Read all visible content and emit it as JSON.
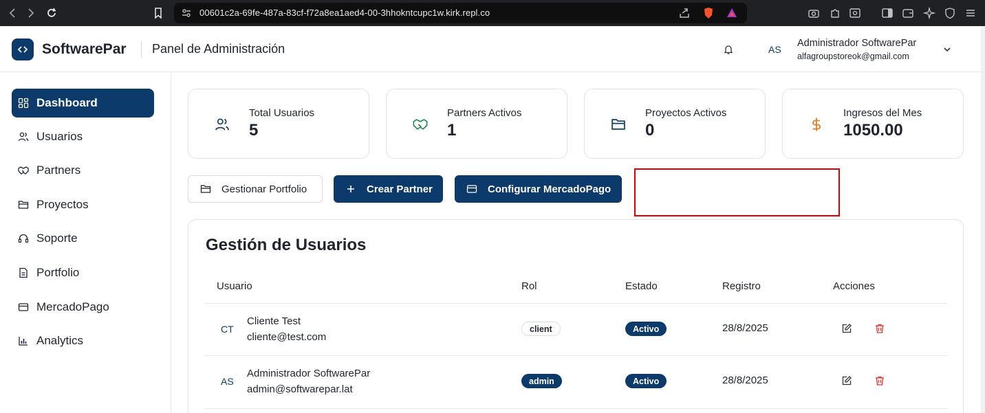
{
  "browser": {
    "url": "00601c2a-69fe-487a-83cf-f72a8ea1aed4-00-3hhokntcupc1w.kirk.repl.co"
  },
  "header": {
    "brand": "SoftwarePar",
    "title": "Panel de Administración",
    "user_initials": "AS",
    "user_name": "Administrador SoftwarePar",
    "user_email": "alfagroupstoreok@gmail.com"
  },
  "sidebar": {
    "items": [
      {
        "label": "Dashboard",
        "icon": "dashboard-icon",
        "active": true
      },
      {
        "label": "Usuarios",
        "icon": "users-icon"
      },
      {
        "label": "Partners",
        "icon": "handshake-icon"
      },
      {
        "label": "Proyectos",
        "icon": "folder-icon"
      },
      {
        "label": "Soporte",
        "icon": "headset-icon"
      },
      {
        "label": "Portfolio",
        "icon": "file-icon"
      },
      {
        "label": "MercadoPago",
        "icon": "card-icon"
      },
      {
        "label": "Analytics",
        "icon": "bar-chart-icon"
      }
    ]
  },
  "stats": [
    {
      "label": "Total Usuarios",
      "value": "5",
      "icon": "users-icon",
      "color": "#0c3a6b"
    },
    {
      "label": "Partners Activos",
      "value": "1",
      "icon": "handshake-icon",
      "color": "#1f8a4c"
    },
    {
      "label": "Proyectos Activos",
      "value": "0",
      "icon": "folder-icon",
      "color": "#0c3a6b"
    },
    {
      "label": "Ingresos del Mes",
      "value": "1050.00",
      "icon": "dollar-icon",
      "color": "#d9822b"
    }
  ],
  "actions": {
    "portfolio": "Gestionar Portfolio",
    "create_partner": "Crear Partner",
    "mercadopago": "Configurar MercadoPago"
  },
  "users_panel": {
    "title": "Gestión de Usuarios",
    "columns": [
      "Usuario",
      "Rol",
      "Estado",
      "Registro",
      "Acciones"
    ],
    "rows": [
      {
        "initials": "CT",
        "name": "Cliente Test",
        "email": "cliente@test.com",
        "role": "client",
        "status": "Activo",
        "date": "28/8/2025"
      },
      {
        "initials": "AS",
        "name": "Administrador SoftwarePar",
        "email": "admin@softwarepar.lat",
        "role": "admin",
        "status": "Activo",
        "date": "28/8/2025"
      }
    ]
  },
  "colors": {
    "primary": "#0c3a6b",
    "danger": "#e03131",
    "highlight_box": "#e00000"
  }
}
